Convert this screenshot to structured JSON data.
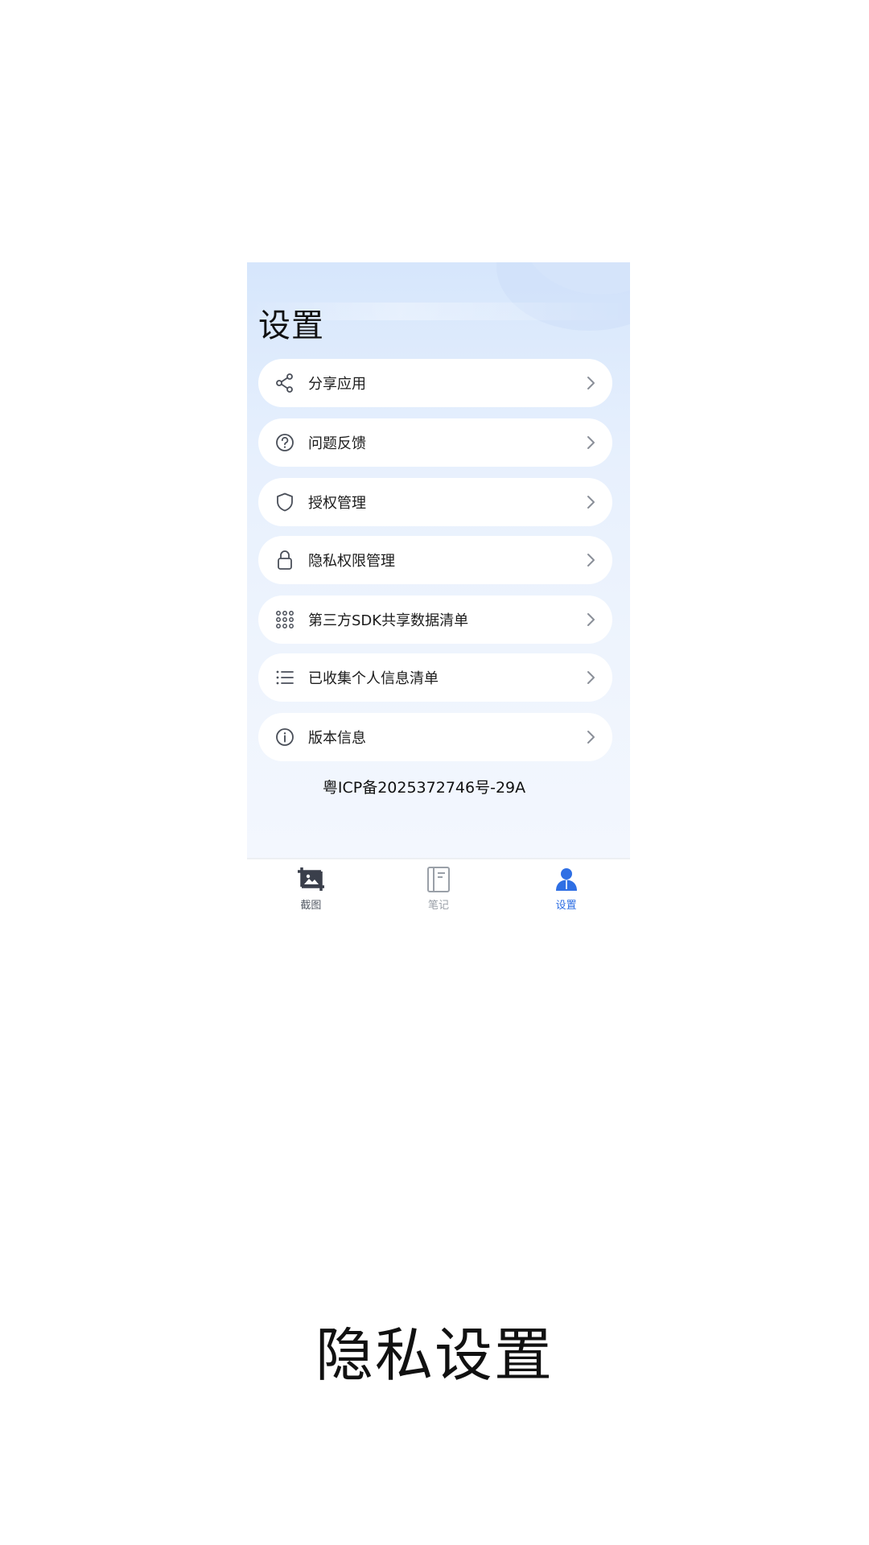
{
  "page": {
    "title": "设置",
    "caption": "隐私设置",
    "icp": "粤ICP备2025372746号-29A"
  },
  "menu": {
    "items": [
      {
        "label": "分享应用",
        "icon": "share-icon"
      },
      {
        "label": "问题反馈",
        "icon": "question-circle-icon"
      },
      {
        "label": "授权管理",
        "icon": "shield-icon"
      },
      {
        "label": "隐私权限管理",
        "icon": "lock-icon"
      },
      {
        "label": "第三方SDK共享数据清单",
        "icon": "dots-grid-icon"
      },
      {
        "label": "已收集个人信息清单",
        "icon": "list-icon"
      },
      {
        "label": "版本信息",
        "icon": "info-circle-icon"
      }
    ]
  },
  "tabbar": {
    "tabs": [
      {
        "label": "截图",
        "icon": "crop-image-icon",
        "state": "default"
      },
      {
        "label": "笔记",
        "icon": "notebook-icon",
        "state": "inactive"
      },
      {
        "label": "设置",
        "icon": "user-icon",
        "state": "active"
      }
    ]
  },
  "colors": {
    "accent": "#2f6fe4",
    "icon_gray": "#4a4f59",
    "chevron": "#8a8f98"
  }
}
